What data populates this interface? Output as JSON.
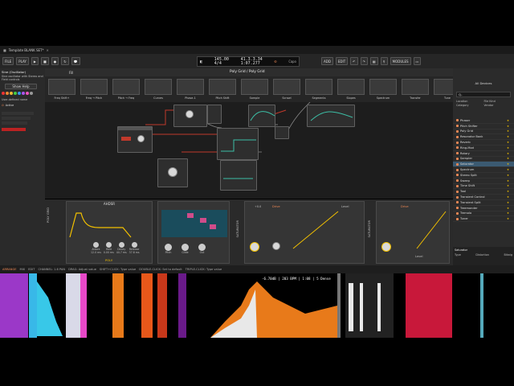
{
  "titlebar": {
    "title": "Template BLANK SET*",
    "close": "✕"
  },
  "toolbar": {
    "file": "FILE",
    "play": "PLAY",
    "tempo": "145.00",
    "signature": "4/4",
    "position": "41.3.3.34",
    "time": "1:07.277",
    "cpu": "Capo",
    "add": "ADD",
    "edit": "EDIT",
    "modules": "MODULES"
  },
  "left_panel": {
    "title": "Sine (Oscillator)",
    "desc": "Sine oscillator with Stereo and Field controls",
    "help": "Show Help",
    "user_defined": "User-defined name",
    "active": "Active",
    "colors": [
      "#e33",
      "#e83",
      "#eb3",
      "#4c4",
      "#39e",
      "#a5e",
      "#e5b",
      "#999"
    ]
  },
  "grid_header": {
    "tab": "Fill",
    "title": "Poly Grid / Poly Grid"
  },
  "palette": [
    "Freq Shift+",
    "Freq → Pitch",
    "Pitch → Freq",
    "Curves",
    "Phase-1",
    "Pitch Shift",
    "Sample",
    "Scrawl",
    "Segments",
    "Slopes",
    "Spectrum",
    "Transfer",
    "Tune"
  ],
  "right_panel": {
    "header": "All Devices",
    "search": "Q-",
    "filters": [
      "Location",
      "File Kind",
      "Category",
      "Vendor"
    ],
    "devices": [
      {
        "name": "Phaser",
        "star": true
      },
      {
        "name": "Pitch Shifter",
        "star": true
      },
      {
        "name": "Poly Grid",
        "star": true
      },
      {
        "name": "Resonator Bank",
        "star": true
      },
      {
        "name": "Reverb",
        "star": true
      },
      {
        "name": "Ring-Mod",
        "star": true
      },
      {
        "name": "Rotary",
        "star": true
      },
      {
        "name": "Sampler",
        "star": true
      },
      {
        "name": "Saturator",
        "star": true,
        "selected": true
      },
      {
        "name": "Spectrum",
        "star": true
      },
      {
        "name": "Stereo Split",
        "star": true
      },
      {
        "name": "Sweep",
        "star": true
      },
      {
        "name": "Time Shift",
        "star": true
      },
      {
        "name": "Tool",
        "star": true
      },
      {
        "name": "Transient Control",
        "star": true
      },
      {
        "name": "Transient Split",
        "star": true
      },
      {
        "name": "Treemonder",
        "star": true
      },
      {
        "name": "Tremolo",
        "star": true
      },
      {
        "name": "Tuner",
        "star": true
      }
    ],
    "footer_name": "Saturator",
    "footer_type": "Type",
    "footer_cat": "Distortion",
    "footer_vendor": "Bitwig"
  },
  "rack": {
    "adsr": "AHDSR",
    "poly": "POLY",
    "poly_grid": "POLY GRID",
    "sat1": "SATURATOR",
    "sat2": "SATURATOR",
    "knobs_a": [
      "Attack",
      "Hold",
      "Decay",
      "Release"
    ],
    "vals_a": [
      "12.0 ms",
      "0.00 ms",
      "44.7 ms",
      "37.8 ms"
    ],
    "labels_b": [
      "Pitch",
      "Glide",
      "Out"
    ],
    "drive1": "Drive",
    "drive2": "Drive",
    "drive1_val": "+8.8",
    "level1": "Level",
    "level2": "Level",
    "shape": "Shape"
  },
  "statusbar": {
    "arrange": "ARRANGE",
    "mix": "MIX",
    "edit": "EDIT",
    "a": "CHANNEL: 1.6 PAN",
    "b": "DRAG: Adjust value",
    "c": "SHIFT+CLICK: Type value",
    "d": "DOUBLE-CLICK: Set to default",
    "e": "TRIPLE-CLICK: Type value"
  },
  "overlay": {
    "text": "-6.70dB  |  203 BPM  |  1:08  |  5 Dense"
  }
}
